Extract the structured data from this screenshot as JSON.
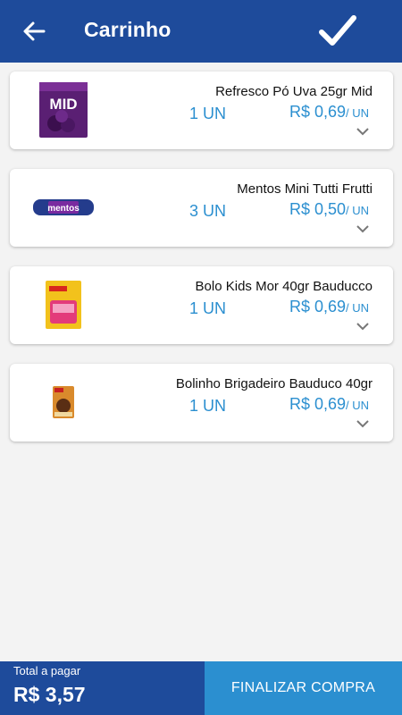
{
  "header": {
    "title": "Carrinho",
    "back_icon": "arrow-left-icon",
    "confirm_icon": "checkmark-icon"
  },
  "items": [
    {
      "name": "Refresco Pó Uva 25gr Mid",
      "qty": "1 UN",
      "price": "R$ 0,69",
      "unit": "/ UN",
      "image": "mid-grape-juice-packet"
    },
    {
      "name": "Mentos Mini Tutti Frutti",
      "qty": "3 UN",
      "price": "R$ 0,50",
      "unit": "/ UN",
      "image": "mentos-roll"
    },
    {
      "name": "Bolo Kids Mor 40gr Bauducco",
      "qty": "1 UN",
      "price": "R$ 0,69",
      "unit": "/ UN",
      "image": "bauducco-bolo-kids-packet"
    },
    {
      "name": "Bolinho Brigadeiro Bauduco 40gr",
      "qty": "1 UN",
      "price": "R$ 0,69",
      "unit": "/ UN",
      "image": "bauducco-bolinho-packet"
    }
  ],
  "footer": {
    "total_label": "Total a pagar",
    "total_value": "R$ 3,57",
    "checkout_label": "FINALIZAR COMPRA"
  },
  "colors": {
    "primary": "#1e4b9b",
    "accent": "#2b8fd0",
    "background": "#f3f3f3"
  }
}
